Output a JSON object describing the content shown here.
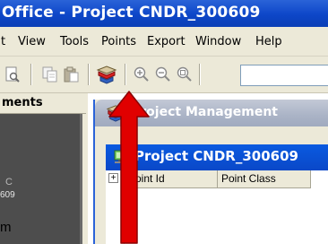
{
  "window": {
    "title": "Office - Project CNDR_300609"
  },
  "menubar": {
    "items": [
      "t",
      "View",
      "Tools",
      "Points",
      "Export",
      "Window",
      "Help"
    ]
  },
  "toolbar": {
    "icons": [
      "print-preview-icon",
      "copy-icon",
      "paste-icon",
      "project-manager-icon",
      "zoom-in-icon",
      "zoom-out-icon",
      "zoom-extents-icon"
    ]
  },
  "left_panel": {
    "header": "ments",
    "letter": "C",
    "number": "609",
    "bottom_letter": "m"
  },
  "project_management": {
    "title": "Project Management"
  },
  "project_window": {
    "title": "Project CNDR_300609",
    "tree_expander": "+",
    "columns": [
      "Point Id",
      "Point Class"
    ]
  },
  "annotation": {
    "arrow_color": "#e00000"
  }
}
